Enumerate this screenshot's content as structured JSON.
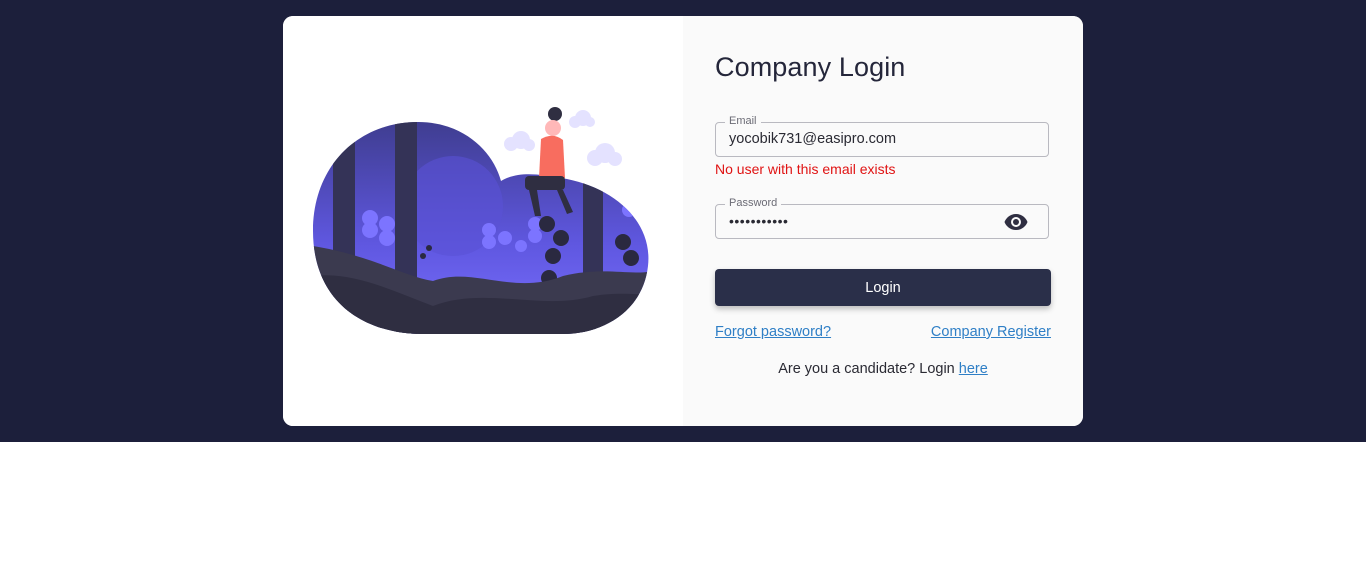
{
  "login": {
    "title": "Company Login",
    "email": {
      "label": "Email",
      "value": "yocobik731@easipro.com"
    },
    "email_error": "No user with this email exists",
    "password": {
      "label": "Password",
      "masked_value": "•••••••••••",
      "visibility_icon": "eye-icon"
    },
    "submit_label": "Login",
    "forgot_password_label": "Forgot password?",
    "register_label": "Company Register",
    "candidate_prompt": "Are you a candidate? Login ",
    "candidate_link": "here"
  },
  "theme": {
    "backdrop": "#1c1f3b",
    "button": "#2a2f49",
    "error": "#e01313",
    "link": "#2f7fc6",
    "illustration_accent": "#6c63ff"
  }
}
